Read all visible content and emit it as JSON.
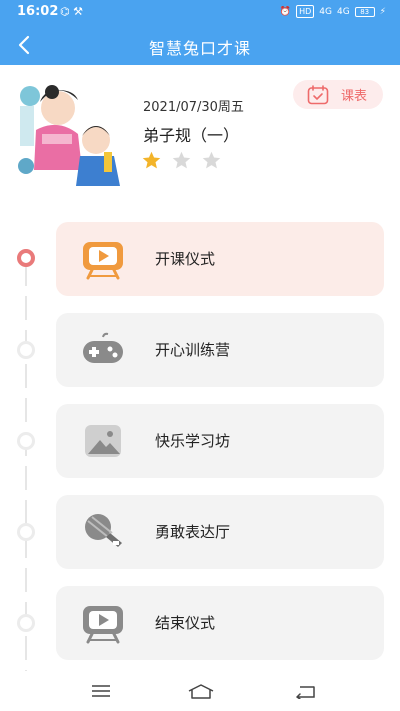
{
  "status_bar": {
    "time": "16:02",
    "left_icons": "⌬ ⚒",
    "right": {
      "hd": "HD",
      "signal1": "4G",
      "signal2": "4G",
      "battery": "83"
    }
  },
  "nav": {
    "title": "智慧兔口才课",
    "back_icon": "chevron-left-icon"
  },
  "lesson": {
    "date": "2021/07/30周五",
    "title": "弟子规（一）",
    "rating": 1,
    "rating_max": 3,
    "schedule_label": "课表"
  },
  "steps": [
    {
      "label": "开课仪式",
      "icon": "tv-play-icon",
      "active": true
    },
    {
      "label": "开心训练营",
      "icon": "gamepad-icon",
      "active": false
    },
    {
      "label": "快乐学习坊",
      "icon": "picture-icon",
      "active": false
    },
    {
      "label": "勇敢表达厅",
      "icon": "microphone-icon",
      "active": false
    },
    {
      "label": "结束仪式",
      "icon": "tv-play-icon",
      "active": false
    }
  ],
  "colors": {
    "header": "#4aa3f0",
    "accent_red": "#ee6a6a",
    "star_on": "#f3b42a",
    "star_off": "#d9d9d9",
    "active_orange": "#f09a3e"
  },
  "bottom_nav": [
    "menu-icon",
    "home-icon",
    "back-icon"
  ]
}
